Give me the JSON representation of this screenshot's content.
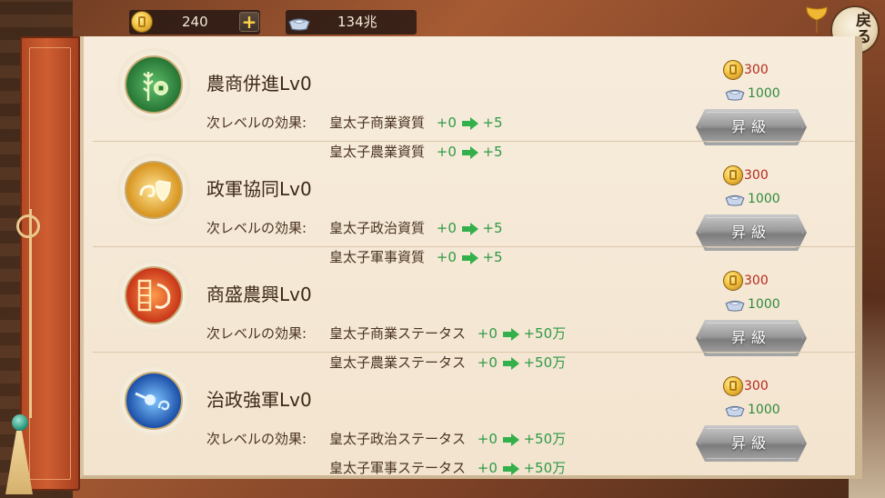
{
  "currency": {
    "gold_value": "240",
    "plus_label": "+",
    "gem_value": "134兆"
  },
  "back_button": {
    "label": "戻る"
  },
  "effects_label": "次レベルの効果:",
  "skills": [
    {
      "title": "農商併進Lv0",
      "icon": "wheat-coin-icon",
      "effects": [
        {
          "stat": "皇太子商業資質",
          "from": "+0",
          "to": "+5"
        },
        {
          "stat": "皇太子農業資質",
          "from": "+0",
          "to": "+5"
        }
      ],
      "cost_gold": "300",
      "cost_gem": "1000",
      "button_label": "昇級"
    },
    {
      "title": "政軍協同Lv0",
      "icon": "scroll-shield-icon",
      "effects": [
        {
          "stat": "皇太子政治資質",
          "from": "+0",
          "to": "+5"
        },
        {
          "stat": "皇太子軍事資質",
          "from": "+0",
          "to": "+5"
        }
      ],
      "cost_gold": "300",
      "cost_gem": "1000",
      "button_label": "昇級"
    },
    {
      "title": "商盛農興Lv0",
      "icon": "abacus-sickle-icon",
      "effects": [
        {
          "stat": "皇太子商業ステータス",
          "from": "+0",
          "to": "+50万"
        },
        {
          "stat": "皇太子農業ステータス",
          "from": "+0",
          "to": "+50万"
        }
      ],
      "cost_gold": "300",
      "cost_gem": "1000",
      "button_label": "昇級"
    },
    {
      "title": "治政強軍Lv0",
      "icon": "comet-swirl-icon",
      "effects": [
        {
          "stat": "皇太子政治ステータス",
          "from": "+0",
          "to": "+50万"
        },
        {
          "stat": "皇太子軍事ステータス",
          "from": "+0",
          "to": "+50万"
        }
      ],
      "cost_gold": "300",
      "cost_gem": "1000",
      "button_label": "昇級"
    }
  ],
  "colors": {
    "cost_gold": "#b52a1d",
    "cost_gem": "#2f8a3d",
    "effect_value": "#2f9a45",
    "arrow": "#33b04a"
  }
}
